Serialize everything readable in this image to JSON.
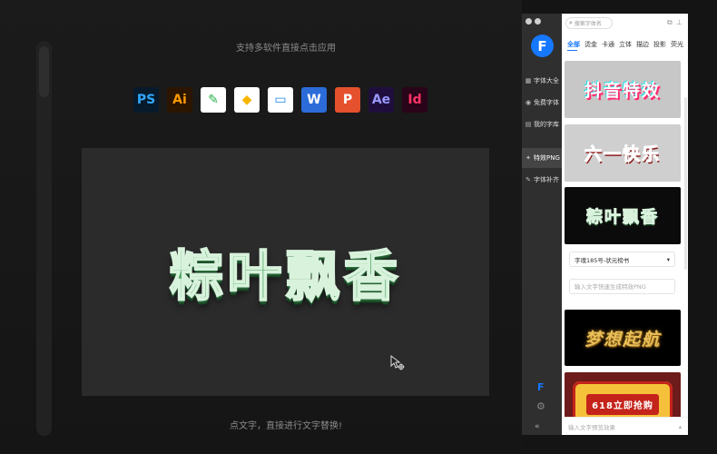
{
  "main": {
    "header_text": "支持多软件直接点击应用",
    "footer_text": "点文字，直接进行文字替换!",
    "preview_text": "粽叶飘香",
    "app_icons": [
      {
        "label": "PS",
        "name": "photoshop",
        "bg": "#071a2b",
        "fg": "#31a8ff"
      },
      {
        "label": "Ai",
        "name": "illustrator",
        "bg": "#2b1400",
        "fg": "#ff9a00"
      },
      {
        "label": "✎",
        "name": "coreldraw",
        "bg": "#ffffff",
        "fg": "#2bb24c"
      },
      {
        "label": "◆",
        "name": "sketch",
        "bg": "#ffffff",
        "fg": "#f7b500"
      },
      {
        "label": "▭",
        "name": "keynote",
        "bg": "#ffffff",
        "fg": "#1f86f0"
      },
      {
        "label": "W",
        "name": "word",
        "bg": "#2b6cd9",
        "fg": "#ffffff"
      },
      {
        "label": "P",
        "name": "powerpoint",
        "bg": "#e5502d",
        "fg": "#ffffff"
      },
      {
        "label": "Ae",
        "name": "after-effects",
        "bg": "#1f0e3d",
        "fg": "#9999ff"
      },
      {
        "label": "Id",
        "name": "indesign",
        "bg": "#2a0418",
        "fg": "#ff3366"
      }
    ]
  },
  "panel": {
    "logo": "F",
    "search": {
      "placeholder": "搜索字体名"
    },
    "sidebar_items": [
      {
        "label": "字体大全",
        "icon": "▦",
        "name": "grid-icon"
      },
      {
        "label": "免费字体",
        "icon": "◉",
        "name": "free-icon"
      },
      {
        "label": "我的字库",
        "icon": "▤",
        "name": "library-icon"
      },
      {
        "label": "特效PNG",
        "icon": "✦",
        "name": "effect-icon"
      },
      {
        "label": "字体补齐",
        "icon": "✎",
        "name": "wrench-icon"
      }
    ],
    "tabs": [
      "全部",
      "烫金",
      "卡通",
      "立体",
      "描边",
      "投影",
      "荧光"
    ],
    "cards": [
      "抖音特效",
      "六一快乐",
      "粽叶飘香",
      "梦想起航",
      "618立即抢购"
    ],
    "font_select": {
      "value": "字魂185号-状元榜书",
      "arrow": "▾"
    },
    "text_input": {
      "placeholder": "输入文字快速生成特效PNG"
    },
    "bottom_input": {
      "placeholder": "输入文字预览效果",
      "arrow": "▴"
    },
    "collapse": "«"
  }
}
